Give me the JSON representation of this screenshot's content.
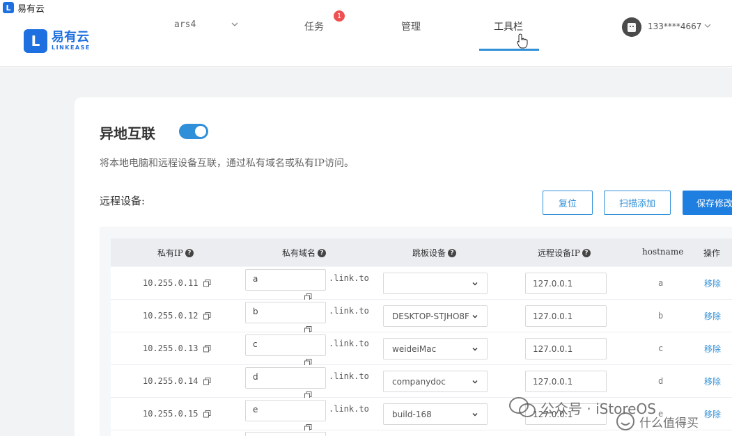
{
  "window": {
    "title": "易有云",
    "icon": "app-logo-icon"
  },
  "nav": {
    "logo_cn": "易有云",
    "logo_en": "LINKEASE",
    "device": "ars4",
    "tasks": "任务",
    "tasks_badge": "1",
    "manage": "管理",
    "tools": "工具栏",
    "user": "133****4667"
  },
  "section": {
    "title": "异地互联",
    "enabled": true,
    "description": "将本地电脑和远程设备互联，通过私有域名或私有IP访问。",
    "remote_label": "远程设备:"
  },
  "buttons": {
    "reset": "复位",
    "scan_add": "扫描添加",
    "save": "保存修改"
  },
  "table": {
    "headers": {
      "private_ip": "私有IP",
      "private_domain": "私有域名",
      "jump_device": "跳板设备",
      "remote_ip": "远程设备IP",
      "hostname": "hostname",
      "action": "操作"
    },
    "rows": [
      {
        "ip": "10.255.0.11",
        "domain": "a",
        "suffix": ".link.to",
        "jump": "",
        "remote_ip": "127.0.0.1",
        "hostname": "a",
        "action": "移除"
      },
      {
        "ip": "10.255.0.12",
        "domain": "b",
        "suffix": ".link.to",
        "jump": "DESKTOP-STJHO8F",
        "remote_ip": "127.0.0.1",
        "hostname": "b",
        "action": "移除"
      },
      {
        "ip": "10.255.0.13",
        "domain": "c",
        "suffix": ".link.to",
        "jump": "weideiMac",
        "remote_ip": "127.0.0.1",
        "hostname": "c",
        "action": "移除"
      },
      {
        "ip": "10.255.0.14",
        "domain": "d",
        "suffix": ".link.to",
        "jump": "companydoc",
        "remote_ip": "127.0.0.1",
        "hostname": "d",
        "action": "移除"
      },
      {
        "ip": "10.255.0.15",
        "domain": "e",
        "suffix": ".link.to",
        "jump": "build-168",
        "remote_ip": "127.0.0.1",
        "hostname": "e",
        "action": "移除"
      }
    ]
  },
  "watermark": {
    "line1": "公众号 · iStoreOS",
    "line2": "什么值得买"
  },
  "colors": {
    "accent": "#2f8fd8",
    "brand": "#1e6fe0",
    "badge": "#f05050",
    "background": "#f2f3f5"
  }
}
